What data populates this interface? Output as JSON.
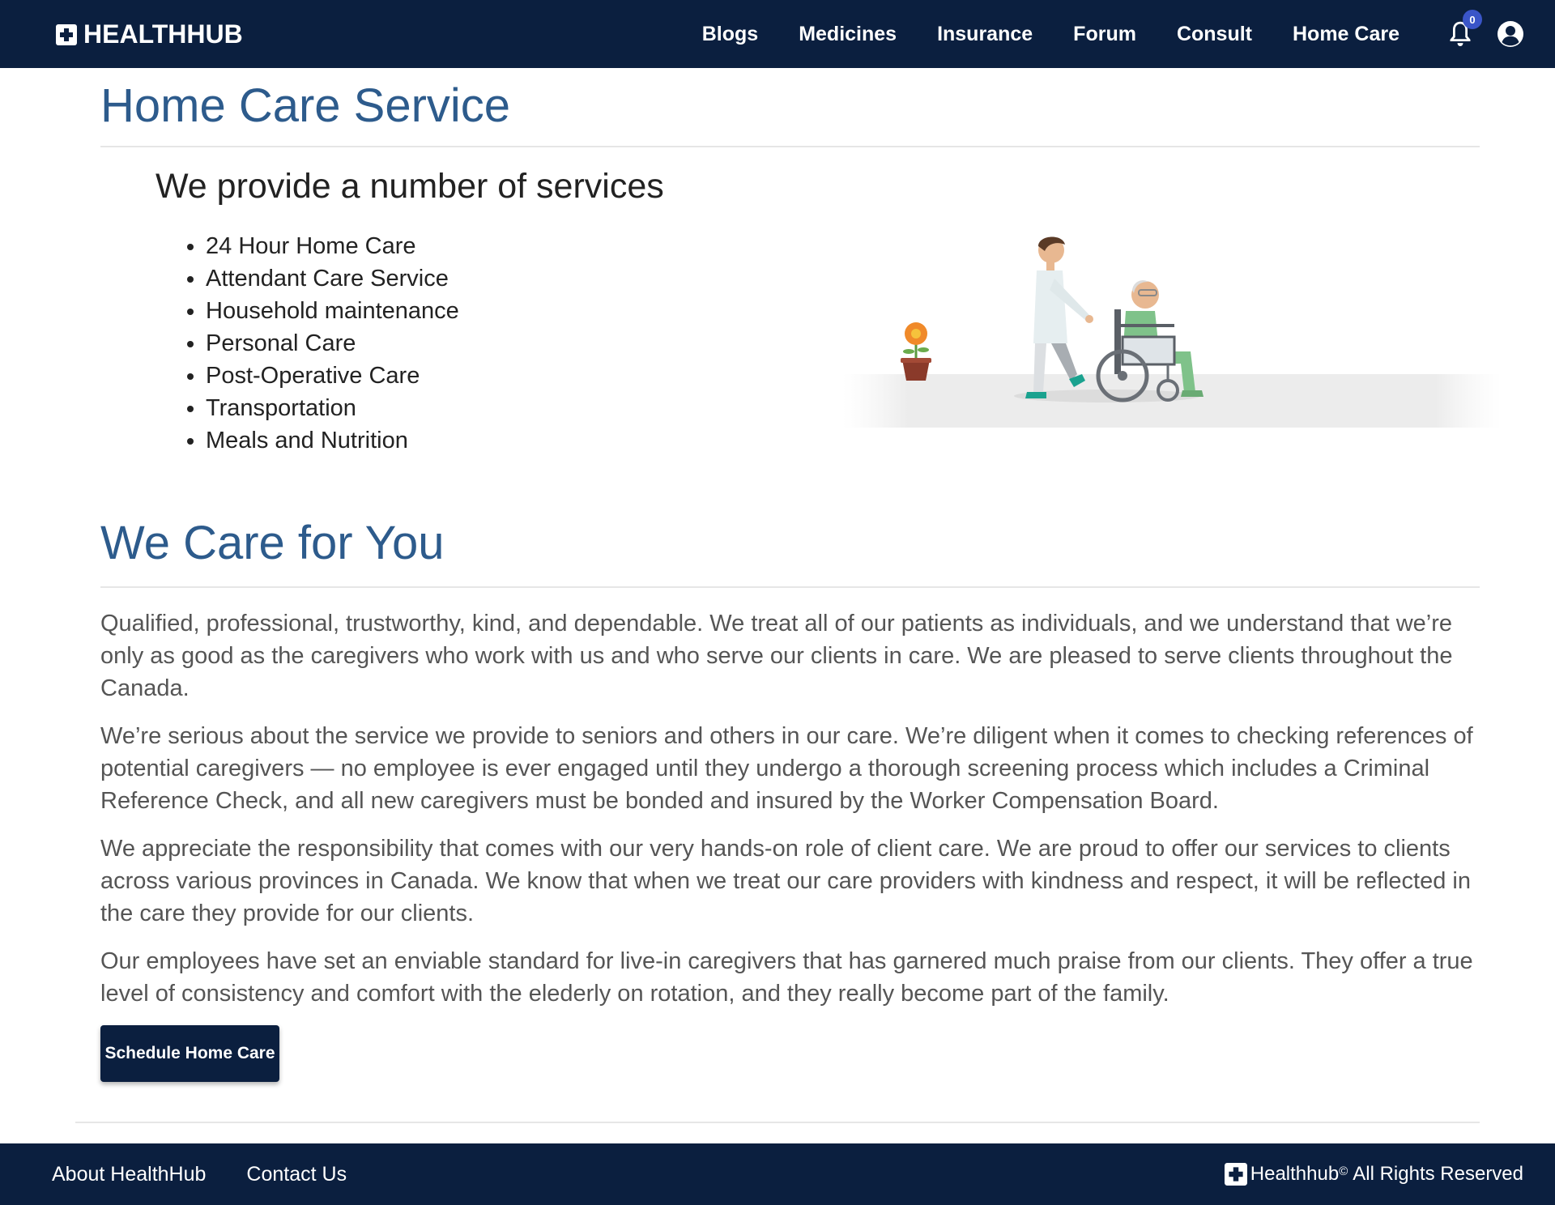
{
  "nav": {
    "brand": "HEALTHHUB",
    "links": [
      "Blogs",
      "Medicines",
      "Insurance",
      "Forum",
      "Consult",
      "Home Care"
    ],
    "notification_count": "0",
    "colors": {
      "navbar": "#0b1f3f",
      "badge": "#3a55c8"
    }
  },
  "main": {
    "title": "Home Care Service",
    "services_heading": "We provide a number of services",
    "services": [
      "24 Hour Home Care",
      "Attendant Care Service",
      "Household maintenance",
      "Personal Care",
      "Post-Operative Care",
      "Transportation",
      "Meals and Nutrition"
    ],
    "care_title": "We Care for You",
    "paragraphs": [
      "Qualified, professional, trustworthy, kind, and dependable. We treat all of our patients as individuals, and we understand that we’re only as good as the caregivers who work with us and who serve our clients in care. We are pleased to serve clients throughout the Canada.",
      "We’re serious about the service we provide to seniors and others in our care. We’re diligent when it comes to checking references of potential caregivers — no employee is ever engaged until they undergo a thorough screening process which includes a Criminal Reference Check, and all new caregivers must be bonded and insured by the Worker Compensation Board.",
      "We appreciate the responsibility that comes with our very hands-on role of client care. We are proud to offer our services to clients across various provinces in Canada. We know that when we treat our care providers with kindness and respect, it will be reflected in the care they provide for our clients.",
      "Our employees have set an enviable standard for live-in caregivers that has garnered much praise from our clients. They offer a true level of consistency and comfort with the elederly on rotation, and they really become part of the family."
    ],
    "cta_label": "Schedule Home Care",
    "title_color": "#2d5b8c"
  },
  "footer": {
    "links": [
      "About HealthHub",
      "Contact Us"
    ],
    "brand": "Healthhub",
    "copyright_mark": "©",
    "rights": "All Rights Reserved"
  }
}
